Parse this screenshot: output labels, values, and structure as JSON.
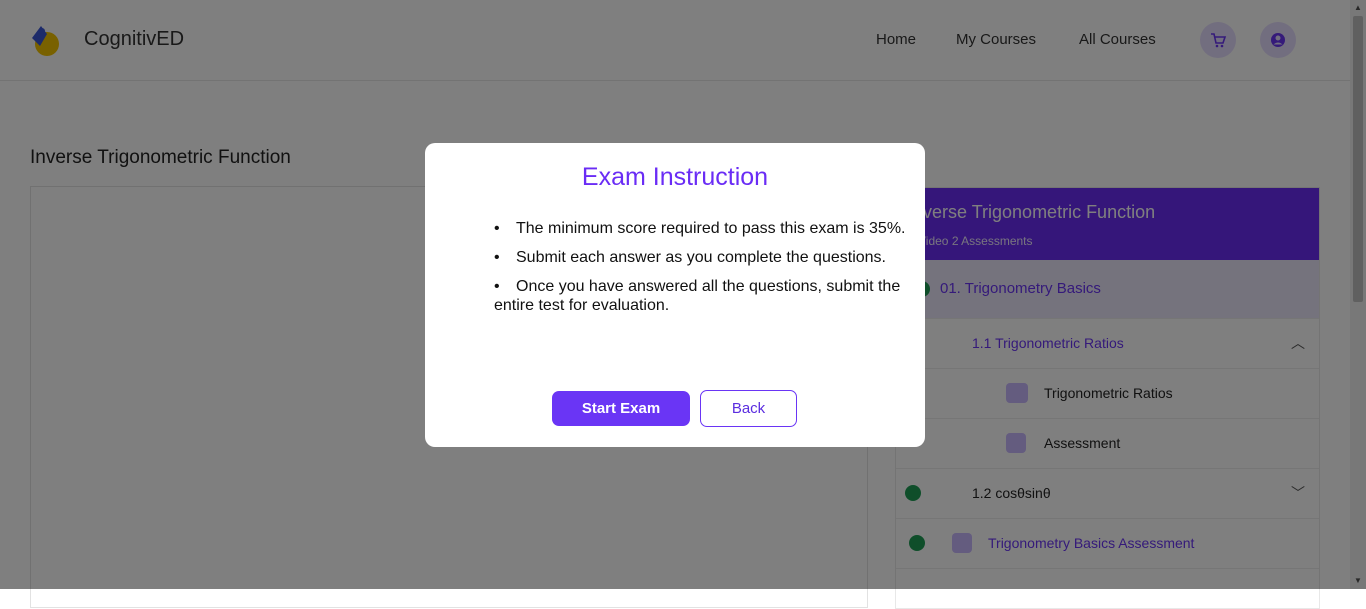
{
  "header": {
    "brand": "CognitivED",
    "nav": [
      "Home",
      "My Courses",
      "All Courses"
    ],
    "cart_icon": "cart-icon",
    "profile_icon": "user-icon"
  },
  "page": {
    "title": "Inverse Trigonometric Function"
  },
  "course_panel": {
    "title": "Inverse Trigonometric Function",
    "meta": "1 Video  2 Assessments",
    "items": [
      {
        "label": "01. Trigonometry Basics"
      },
      {
        "label": "1.1 Trigonometric Ratios"
      },
      {
        "label": "Trigonometric Ratios"
      },
      {
        "label": "Assessment"
      },
      {
        "label": "1.2 cosθsinθ"
      },
      {
        "label": "Trigonometry Basics Assessment"
      }
    ]
  },
  "modal": {
    "title": "Exam Instruction",
    "instructions": [
      "The minimum score required to pass this exam is 35%.",
      "Submit each answer as you complete the questions.",
      "Once you have answered all the questions, submit the entire test for evaluation."
    ],
    "start_label": "Start Exam",
    "back_label": "Back"
  },
  "colors": {
    "accent": "#6a35f5",
    "overlay": "rgba(0,0,0,0.5)",
    "success": "#1f9d55"
  }
}
